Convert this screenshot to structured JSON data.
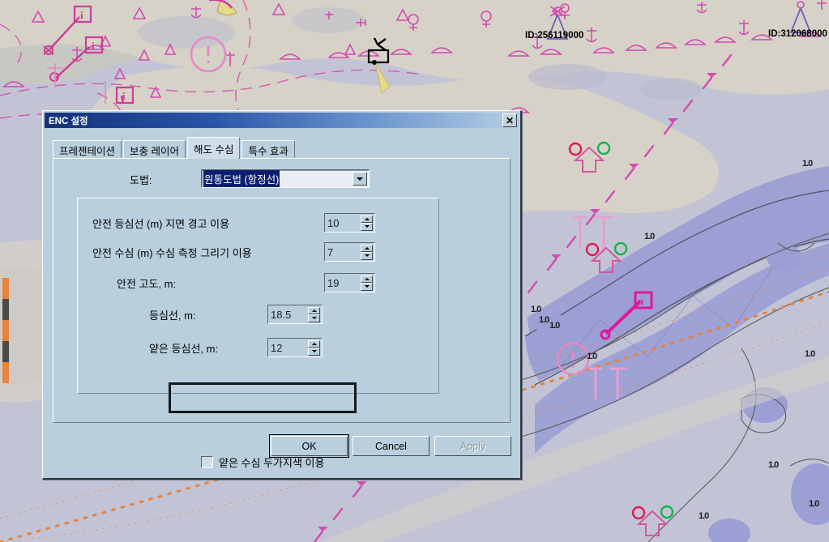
{
  "dialog": {
    "title": "ENC 설정",
    "close_label": "✕",
    "tabs": [
      {
        "label": "프레젠테이션",
        "active": false
      },
      {
        "label": "보충 레이어",
        "active": false
      },
      {
        "label": "해도 수심",
        "active": true
      },
      {
        "label": "특수 효과",
        "active": false
      }
    ],
    "projection": {
      "label": "도법:",
      "selected": "원통도법 (항정선)"
    },
    "fields": [
      {
        "label": "안전 등심선 (m) 지면 경고 이용",
        "value": "10",
        "highlighted": false
      },
      {
        "label": "안전 수심 (m) 수심 측정 그리기 이용",
        "value": "7",
        "highlighted": false
      },
      {
        "label": "안전 고도, m:",
        "value": "19",
        "highlighted": false
      },
      {
        "label": "등심선, m:",
        "value": "18.5",
        "highlighted": true
      },
      {
        "label": "얕은 등심선, m:",
        "value": "12",
        "highlighted": false
      }
    ],
    "checkbox": {
      "label": "얕은 수심 두가지색 이용",
      "checked": false
    },
    "buttons": [
      {
        "label": "OK",
        "state": "default"
      },
      {
        "label": "Cancel",
        "state": "normal"
      },
      {
        "label": "Apply",
        "state": "disabled"
      }
    ]
  },
  "map": {
    "vessel_ids": [
      "ID:256119000",
      "ID:312068000"
    ],
    "depth_labels": [
      "1.0",
      "1.0",
      "1.0",
      "1.0",
      "1.0",
      "1.0",
      "1.0",
      "1.0",
      "1.0"
    ],
    "colors": {
      "deep_water": "#c2c4d6",
      "shallow_water": "#c9c9c0",
      "channel": "#9b9fd4",
      "land": "#d6d2c8",
      "symbol_magenta": "#d44bb0",
      "route_orange": "#e8833a",
      "contour_line": "#5a5a5a",
      "lightsector_yellow": "#e8d98a"
    }
  }
}
